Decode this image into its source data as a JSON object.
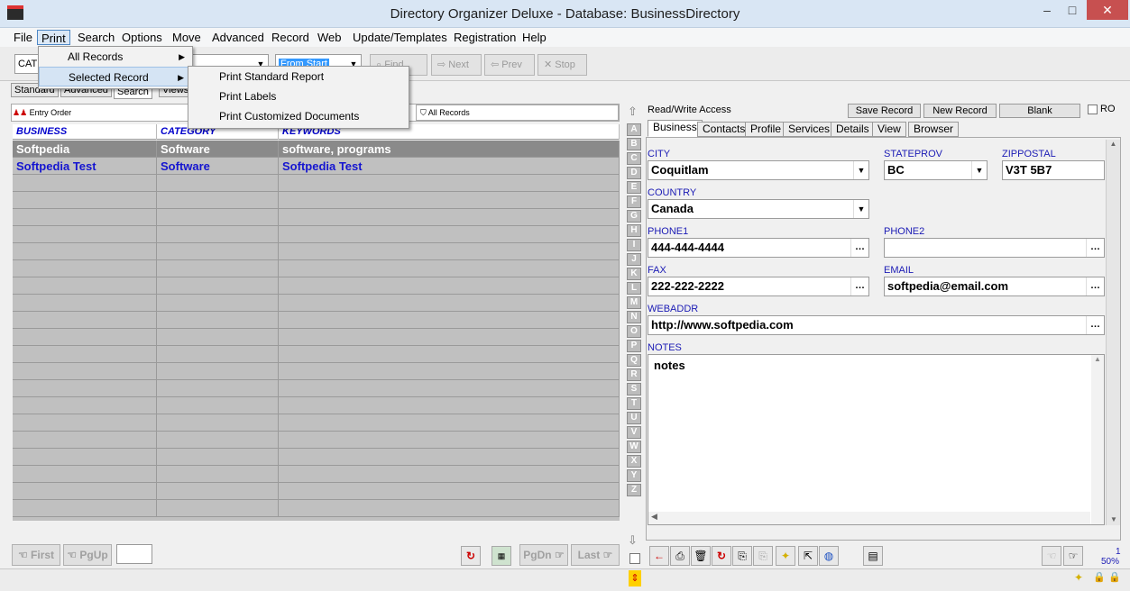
{
  "window": {
    "title": "Directory Organizer Deluxe - Database: BusinessDirectory",
    "minimize": "–",
    "maximize": "□",
    "close": "✕"
  },
  "menu": [
    "File",
    "Print",
    "Search",
    "Options",
    "Move",
    "Advanced",
    "Record",
    "Web",
    "Update/Templates",
    "Registration",
    "Help"
  ],
  "toolbar": {
    "combo1": "CAT",
    "combo2": "From Start",
    "find": "Find",
    "next": "Next",
    "prev": "Prev",
    "stop": "Stop"
  },
  "print_menu": {
    "items": [
      "All Records",
      "Selected Record"
    ]
  },
  "selected_record_menu": {
    "items": [
      "Print Standard Report",
      "Print Labels",
      "Print Customized Documents"
    ]
  },
  "left_tabs": [
    "Standard",
    "Advanced",
    "Search",
    "Views"
  ],
  "sort_bar": {
    "order": "Entry Order",
    "filter": "All Records"
  },
  "grid": {
    "columns": [
      "BUSINESS",
      "CATEGORY",
      "KEYWORDS"
    ],
    "rows": [
      {
        "business": "Softpedia",
        "category": "Software",
        "keywords": "software, programs",
        "selected": true
      },
      {
        "business": "Softpedia Test",
        "category": "Software",
        "keywords": "Softpedia Test",
        "selected": false
      }
    ]
  },
  "letters": [
    "A",
    "B",
    "C",
    "D",
    "E",
    "F",
    "G",
    "H",
    "I",
    "J",
    "K",
    "L",
    "M",
    "N",
    "O",
    "P",
    "Q",
    "R",
    "S",
    "T",
    "U",
    "V",
    "W",
    "X",
    "Y",
    "Z"
  ],
  "right_header": {
    "access": "Read/Write Access",
    "save": "Save Record",
    "new": "New Record",
    "blank": "Blank",
    "ro": "RO"
  },
  "detail_tabs": [
    "Business",
    "Contacts",
    "Profile",
    "Services",
    "Details",
    "View",
    "Browser"
  ],
  "detail": {
    "city_label": "CITY",
    "city": "Coquitlam",
    "state_label": "STATEPROV",
    "state": "BC",
    "zip_label": "ZIPPOSTAL",
    "zip": "V3T 5B7",
    "country_label": "COUNTRY",
    "country": "Canada",
    "phone1_label": "PHONE1",
    "phone1": "444-444-4444",
    "phone2_label": "PHONE2",
    "phone2": "",
    "fax_label": "FAX",
    "fax": "222-222-2222",
    "email_label": "EMAIL",
    "email": "softpedia@email.com",
    "web_label": "WEBADDR",
    "web": "http://www.softpedia.com",
    "notes_label": "NOTES",
    "notes": "notes"
  },
  "bottom_nav": {
    "first": "First",
    "pgup": "PgUp",
    "pgdn": "PgDn",
    "last": "Last"
  },
  "status": {
    "count": "1",
    "zoom": "50%"
  }
}
